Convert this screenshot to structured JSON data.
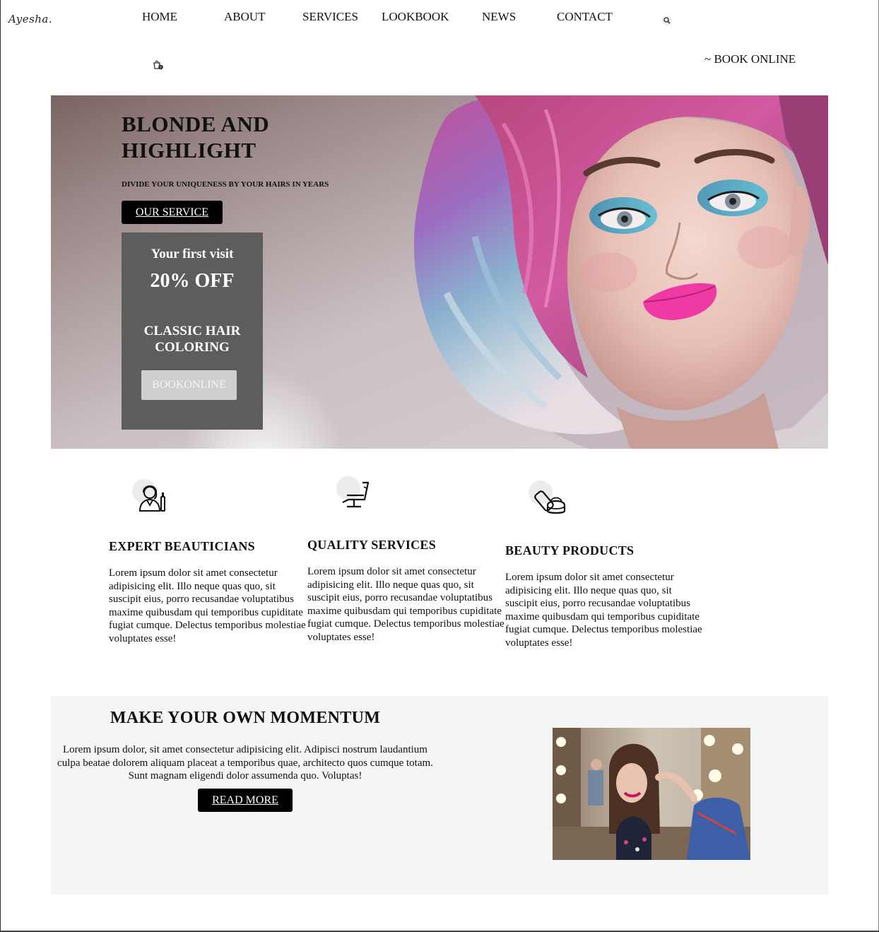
{
  "header": {
    "logo": "Ayesha.",
    "nav": [
      "HOME",
      "ABOUT",
      "SERVICES",
      "LOOKBOOK",
      "NEWS",
      "CONTACT"
    ],
    "search_icon": "search-icon",
    "cart_icon": "shopping-bag-icon",
    "book_online": "~ BOOK ONLINE"
  },
  "hero": {
    "title_line1": "BLONDE AND",
    "title_line2": "HIGHLIGHT",
    "subtitle": "DIVIDE YOUR UNIQUENESS BY YOUR HAIRS IN YEARS",
    "button": "OUR SERVICE"
  },
  "promo": {
    "line1": "Your first visit",
    "line2": "20% OFF",
    "line3": "CLASSIC HAIR COLORING",
    "button": "BOOKONLINE"
  },
  "features": [
    {
      "icon": "beautician-icon",
      "title": "EXPERT BEAUTICIANS",
      "text": "Lorem ipsum dolor sit amet consectetur adipisicing elit. Illo neque quas quo, sit suscipit eius, porro recusandae voluptatibus maxime quibusdam qui temporibus cupiditate fugiat cumque. Delectus temporibus molestiae voluptates esse!"
    },
    {
      "icon": "salon-chair-icon",
      "title": "QUALITY SERVICES",
      "text": "Lorem ipsum dolor sit amet consectetur adipisicing elit. Illo neque quas quo, sit suscipit eius, porro recusandae voluptatibus maxime quibusdam qui temporibus cupiditate fugiat cumque. Delectus temporibus molestiae voluptates esse!"
    },
    {
      "icon": "beauty-products-icon",
      "title": "BEAUTY PRODUCTS",
      "text": "Lorem ipsum dolor sit amet consectetur adipisicing elit. Illo neque quas quo, sit suscipit eius, porro recusandae voluptatibus maxime quibusdam qui temporibus cupiditate fugiat cumque. Delectus temporibus molestiae voluptates esse!"
    }
  ],
  "momentum": {
    "title": "MAKE YOUR OWN MOMENTUM",
    "text": "Lorem ipsum dolor, sit amet consectetur adipisicing elit. Adipisci nostrum laudantium culpa beatae dolorem aliquam placeat a temporibus quae, architecto quos cumque totam. Sunt magnam eligendi dolor assumenda quo. Voluptas!",
    "button": "READ MORE"
  },
  "colors": {
    "promo_bg": "#5d5d5d",
    "button_dark": "#000000",
    "section_bg": "#f5f5f5",
    "hair_pink": "#c8468f",
    "hair_blue": "#8fb6cc",
    "lip_pink": "#f03aa3"
  }
}
